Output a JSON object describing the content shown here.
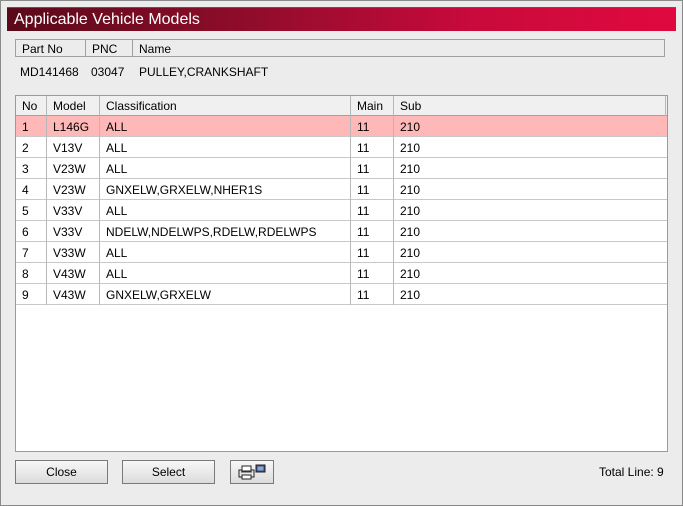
{
  "window": {
    "title": "Applicable Vehicle Models"
  },
  "info": {
    "headers": {
      "part_no": "Part No",
      "pnc": "PNC",
      "name": "Name"
    },
    "values": {
      "part_no": "MD141468",
      "pnc": "03047",
      "name": "PULLEY,CRANKSHAFT"
    }
  },
  "table": {
    "headers": {
      "no": "No",
      "model": "Model",
      "classification": "Classification",
      "main": "Main",
      "sub": "Sub"
    },
    "rows": [
      {
        "no": "1",
        "model": "L146G",
        "classification": "ALL",
        "main": "11",
        "sub": "210",
        "selected": true
      },
      {
        "no": "2",
        "model": "V13V",
        "classification": "ALL",
        "main": "11",
        "sub": "210"
      },
      {
        "no": "3",
        "model": "V23W",
        "classification": "ALL",
        "main": "11",
        "sub": "210"
      },
      {
        "no": "4",
        "model": "V23W",
        "classification": "GNXELW,GRXELW,NHER1S",
        "main": "11",
        "sub": "210"
      },
      {
        "no": "5",
        "model": "V33V",
        "classification": "ALL",
        "main": "11",
        "sub": "210"
      },
      {
        "no": "6",
        "model": "V33V",
        "classification": "NDELW,NDELWPS,RDELW,RDELWPS",
        "main": "11",
        "sub": "210"
      },
      {
        "no": "7",
        "model": "V33W",
        "classification": "ALL",
        "main": "11",
        "sub": "210"
      },
      {
        "no": "8",
        "model": "V43W",
        "classification": "ALL",
        "main": "11",
        "sub": "210"
      },
      {
        "no": "9",
        "model": "V43W",
        "classification": "GNXELW,GRXELW",
        "main": "11",
        "sub": "210"
      }
    ]
  },
  "footer": {
    "close_label": "Close",
    "select_label": "Select",
    "print_icon": "printer-icon",
    "total_label": "Total Line: 9"
  },
  "colors": {
    "title_start": "#5a0a1a",
    "title_end": "#e0093f",
    "selected_row": "#ffb8b8"
  }
}
